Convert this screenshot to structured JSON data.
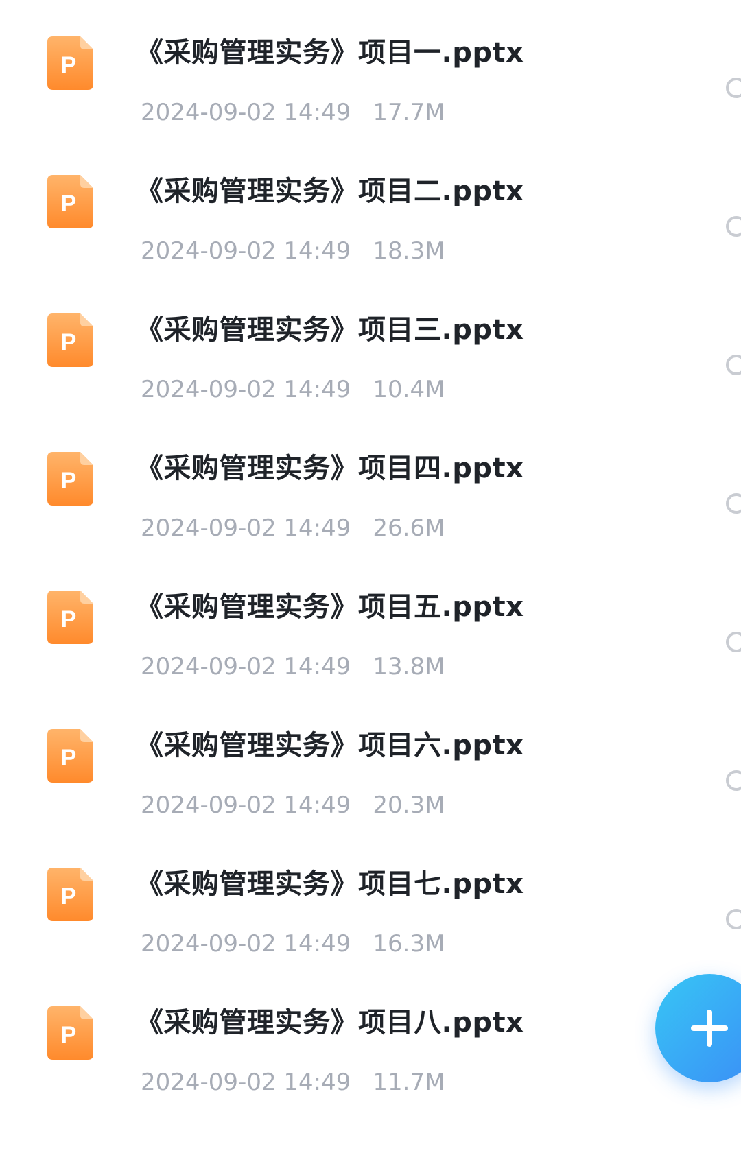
{
  "file_icon": {
    "name": "pptx-file-icon",
    "letter": "P",
    "color_top": "#ffb46a",
    "color_bottom": "#ff8a2c"
  },
  "files": [
    {
      "name": "《采购管理实务》项目一.pptx",
      "date": "2024-09-02 14:49",
      "size": "17.7M"
    },
    {
      "name": "《采购管理实务》项目二.pptx",
      "date": "2024-09-02 14:49",
      "size": "18.3M"
    },
    {
      "name": "《采购管理实务》项目三.pptx",
      "date": "2024-09-02 14:49",
      "size": "10.4M"
    },
    {
      "name": "《采购管理实务》项目四.pptx",
      "date": "2024-09-02 14:49",
      "size": "26.6M"
    },
    {
      "name": "《采购管理实务》项目五.pptx",
      "date": "2024-09-02 14:49",
      "size": "13.8M"
    },
    {
      "name": "《采购管理实务》项目六.pptx",
      "date": "2024-09-02 14:49",
      "size": "20.3M"
    },
    {
      "name": "《采购管理实务》项目七.pptx",
      "date": "2024-09-02 14:49",
      "size": "16.3M"
    },
    {
      "name": "《采购管理实务》项目八.pptx",
      "date": "2024-09-02 14:49",
      "size": "11.7M"
    }
  ],
  "fab": {
    "icon": "plus-icon",
    "color_start": "#38c6f5",
    "color_end": "#3a8ef6"
  }
}
